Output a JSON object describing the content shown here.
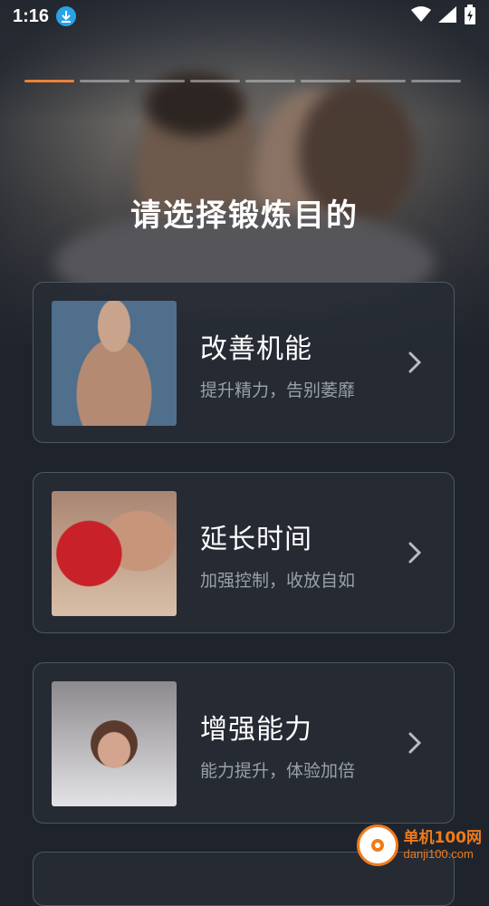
{
  "status_bar": {
    "time": "1:16"
  },
  "progress": {
    "total_steps": 8,
    "current_step": 1
  },
  "page_title": "请选择锻炼目的",
  "options": [
    {
      "title": "改善机能",
      "subtitle": "提升精力，告别萎靡"
    },
    {
      "title": "延长时间",
      "subtitle": "加强控制，收放自如"
    },
    {
      "title": "增强能力",
      "subtitle": "能力提升，体验加倍"
    }
  ],
  "watermark": {
    "name": "单机100网",
    "domain": "danji100.com"
  },
  "colors": {
    "accent": "#e8833a",
    "background": "#1f242c",
    "card": "#262b34",
    "subtitle": "#9aa0a8"
  }
}
